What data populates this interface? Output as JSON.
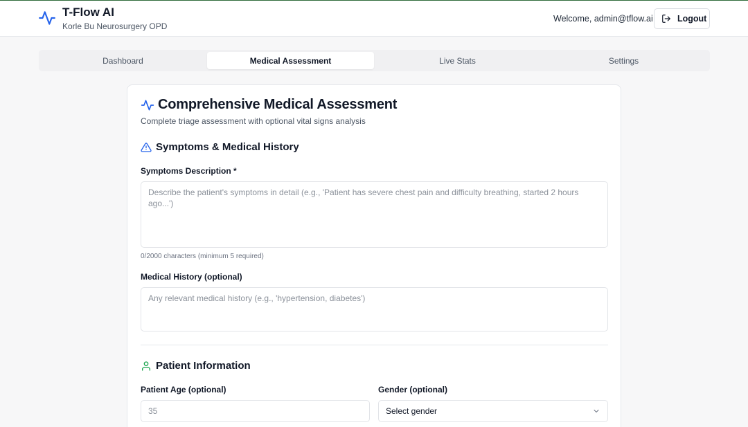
{
  "app": {
    "title": "T-Flow AI",
    "subtitle": "Korle Bu Neurosurgery OPD",
    "welcome": "Welcome, admin@tflow.ai",
    "logout_label": "Logout",
    "accent_color": "#2563eb"
  },
  "tabs": [
    {
      "label": "Dashboard",
      "active": false
    },
    {
      "label": "Medical Assessment",
      "active": true
    },
    {
      "label": "Live Stats",
      "active": false
    },
    {
      "label": "Settings",
      "active": false
    }
  ],
  "assessment": {
    "title": "Comprehensive Medical Assessment",
    "subtitle": "Complete triage assessment with optional vital signs analysis",
    "symptoms_section": {
      "title": "Symptoms & Medical History",
      "icon": "alert-triangle-icon",
      "symptoms_label": "Symptoms Description *",
      "symptoms_placeholder": "Describe the patient's symptoms in detail (e.g., 'Patient has severe chest pain and difficulty breathing, started 2 hours ago...')",
      "symptoms_value": "",
      "counter": "0/2000 characters (minimum 5 required)",
      "history_label": "Medical History (optional)",
      "history_placeholder": "Any relevant medical history (e.g., 'hypertension, diabetes')",
      "history_value": ""
    },
    "patient_section": {
      "title": "Patient Information",
      "icon": "user-icon",
      "age_label": "Patient Age (optional)",
      "age_placeholder": "35",
      "gender_label": "Gender (optional)",
      "gender_value": "Select gender"
    }
  }
}
